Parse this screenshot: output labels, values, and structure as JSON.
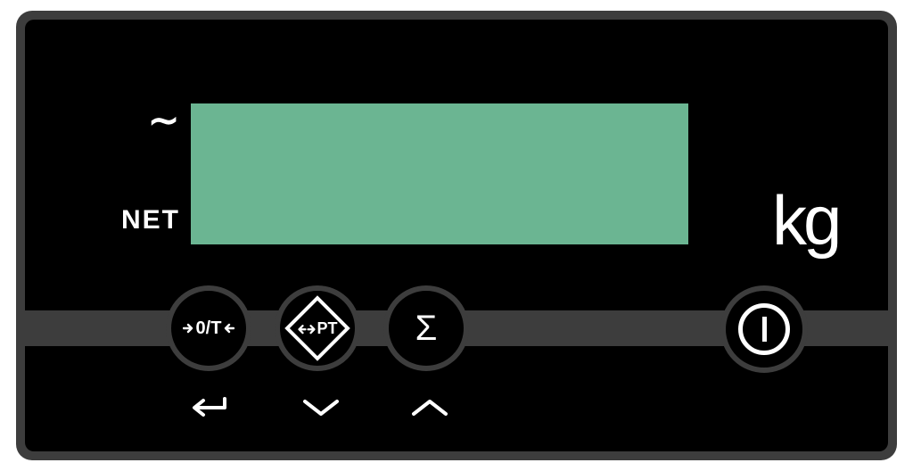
{
  "indicators": {
    "motion_symbol": "∼",
    "net_label": "NET"
  },
  "unit_label": "kg",
  "buttons": {
    "zero_tare": {
      "name": "zero-tare-button",
      "text_center": "0/T"
    },
    "preset_tare": {
      "name": "preset-tare-button",
      "text": "PT"
    },
    "sum": {
      "name": "sum-button",
      "symbol": "Σ"
    },
    "power": {
      "name": "power-button"
    }
  },
  "secondary_keys": {
    "enter": {
      "name": "enter-icon"
    },
    "down": {
      "name": "down-icon"
    },
    "up": {
      "name": "up-icon"
    }
  },
  "colors": {
    "lcd": "#6bb592",
    "bezel": "#3d3d3d",
    "face": "#000000"
  }
}
